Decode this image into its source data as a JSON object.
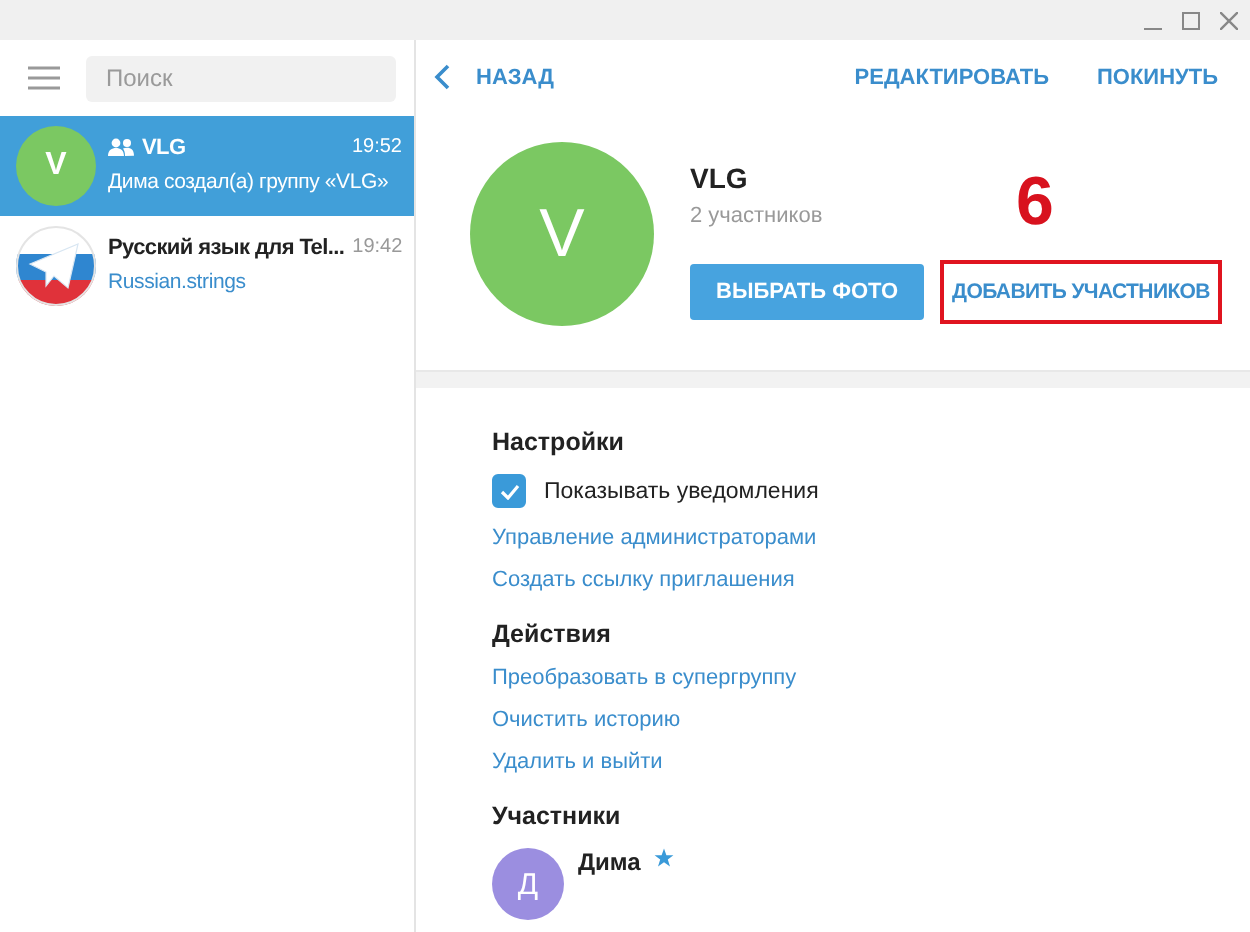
{
  "sidebar": {
    "search": {
      "placeholder": "Поиск"
    },
    "chats": [
      {
        "kind": "group",
        "avatar_letter": "V",
        "name": "VLG",
        "time": "19:52",
        "preview": "Дима создал(а) группу «VLG»",
        "selected": true
      },
      {
        "kind": "channel",
        "name": "Русский язык для Tel...",
        "time": "19:42",
        "preview": "Russian.strings",
        "selected": false
      }
    ]
  },
  "header": {
    "back": "НАЗАД",
    "actions": [
      "РЕДАКТИРОВАТЬ",
      "ПОКИНУТЬ"
    ]
  },
  "profile": {
    "avatar_letter": "V",
    "name": "VLG",
    "status": "2 участников",
    "buttons": [
      {
        "kind": "primary",
        "label": "ВЫБРАТЬ ФОТО"
      },
      {
        "kind": "flat",
        "label": "ДОБАВИТЬ УЧАСТНИКОВ",
        "highlighted": true
      }
    ],
    "annotation": {
      "label": "6"
    }
  },
  "sections": [
    {
      "title": "Настройки",
      "items": [
        {
          "kind": "checkbox",
          "label": "Показывать уведомления",
          "checked": true
        },
        {
          "kind": "link",
          "label": "Управление администраторами"
        },
        {
          "kind": "link",
          "label": "Создать ссылку приглашения"
        }
      ]
    },
    {
      "title": "Действия",
      "items": [
        {
          "kind": "link",
          "label": "Преобразовать в супергруппу"
        },
        {
          "kind": "link",
          "label": "Очистить историю"
        },
        {
          "kind": "link",
          "label": "Удалить и выйти"
        }
      ]
    },
    {
      "title": "Участники",
      "items": [
        {
          "kind": "member",
          "avatar_letter": "Д",
          "label": "Дима",
          "admin": true
        }
      ]
    }
  ]
}
